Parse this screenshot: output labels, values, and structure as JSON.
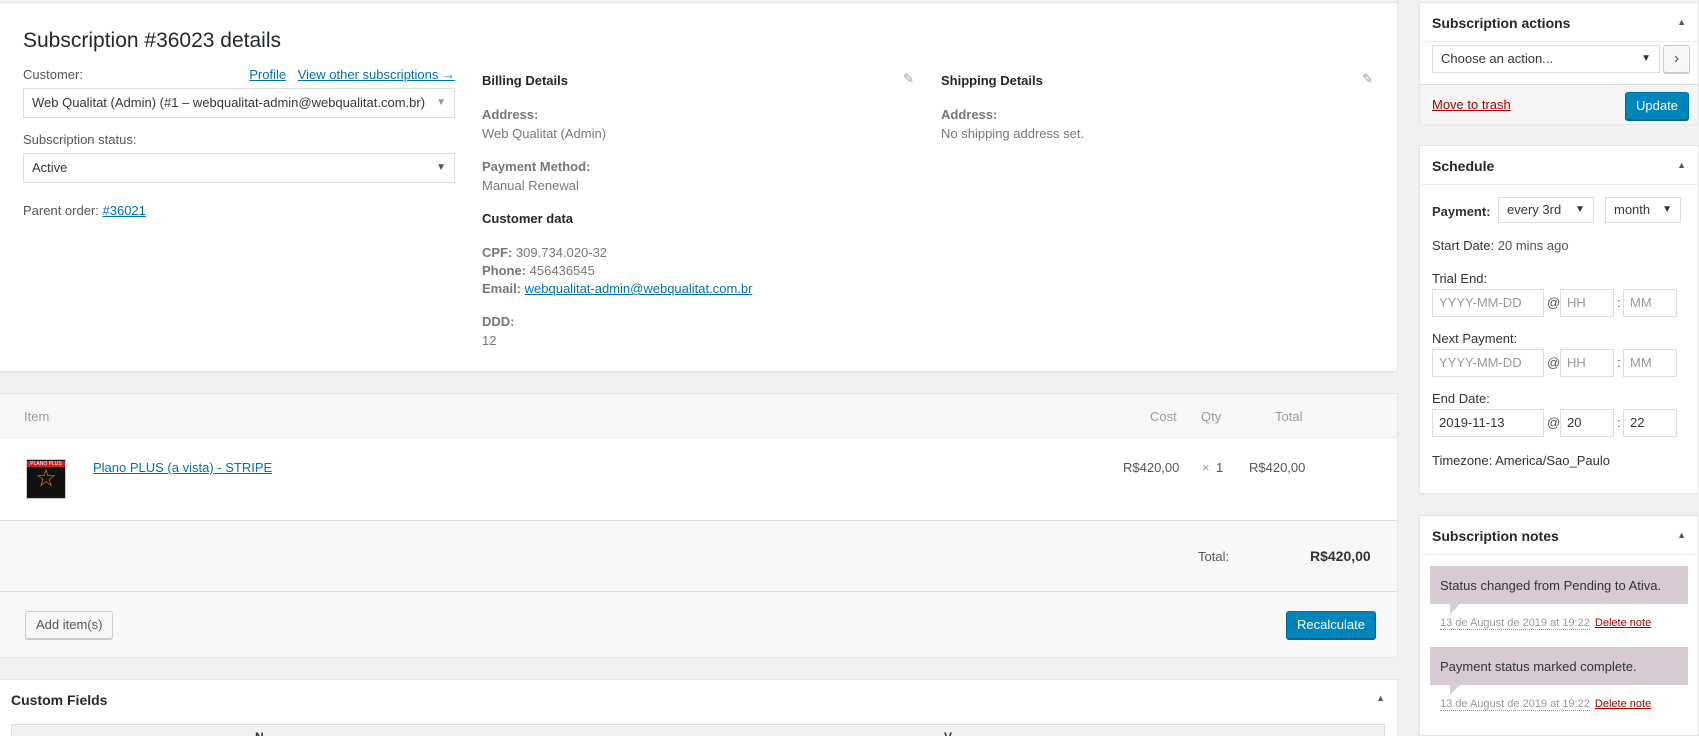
{
  "details": {
    "title": "Subscription #36023 details",
    "customer_label": "Customer:",
    "profile_link": "Profile",
    "other_subs_link": "View other subscriptions →",
    "customer_value": "Web Qualitat (Admin) (#1 – webqualitat-admin@webqualitat.com.br)",
    "status_label": "Subscription status:",
    "status_value": "Active",
    "parent_label": "Parent order: ",
    "parent_link": "#36021"
  },
  "billing": {
    "heading": "Billing Details",
    "address_label": "Address:",
    "address_value": "Web Qualitat (Admin)",
    "payment_label": "Payment Method:",
    "payment_value": "Manual Renewal",
    "customer_data_heading": "Customer data",
    "cpf_label": "CPF:",
    "cpf_value": " 309.734.020-32",
    "phone_label": "Phone:",
    "phone_value": " 456436545",
    "email_label": "Email:",
    "email_value": "webqualitat-admin@webqualitat.com.br",
    "ddd_label": "DDD:",
    "ddd_value": "12"
  },
  "shipping": {
    "heading": "Shipping Details",
    "address_label": "Address:",
    "address_value": "No shipping address set."
  },
  "items": {
    "col_item": "Item",
    "col_cost": "Cost",
    "col_qty": "Qty",
    "col_total": "Total",
    "rows": [
      {
        "thumb_label": "PLANO PLUS",
        "name": "Plano PLUS (a vista) - STRIPE",
        "cost": "R$420,00",
        "qty_mult": "×",
        "qty": "1",
        "total": "R$420,00"
      }
    ],
    "total_label": "Total:",
    "total_value": "R$420,00",
    "add_items": "Add item(s)",
    "recalculate": "Recalculate"
  },
  "custom_fields": {
    "title": "Custom Fields",
    "col_name": "N",
    "col_value": "V"
  },
  "sub_actions": {
    "title": "Subscription actions",
    "action_select": "Choose an action...",
    "go_button": "›",
    "trash_link": "Move to trash",
    "update_button": "Update"
  },
  "schedule": {
    "title": "Schedule",
    "payment_label": "Payment:",
    "interval": "every 3rd",
    "period": "month",
    "start_label": "Start Date:",
    "start_value": " 20 mins ago",
    "trial_label": "Trial End:",
    "next_label": "Next Payment:",
    "end_label": "End Date:",
    "date_placeholder": "YYYY-MM-DD",
    "hour_placeholder": "HH",
    "minute_placeholder": "MM",
    "end_date": "2019-11-13",
    "end_hour": "20",
    "end_minute": "22",
    "at_sign": "@",
    "colon": ":",
    "timezone": "Timezone: America/Sao_Paulo"
  },
  "notes": {
    "title": "Subscription notes",
    "items": [
      {
        "text": "Status changed from Pending to Ativa.",
        "date": "13 de August de 2019 at 19:22",
        "delete": "Delete note"
      },
      {
        "text": "Payment status marked complete.",
        "date": "13 de August de 2019 at 19:22",
        "delete": "Delete note"
      }
    ]
  },
  "colors": {
    "primary": "#0085ba",
    "link": "#0073aa",
    "danger": "#a00",
    "note_bg": "#d7cad2"
  }
}
